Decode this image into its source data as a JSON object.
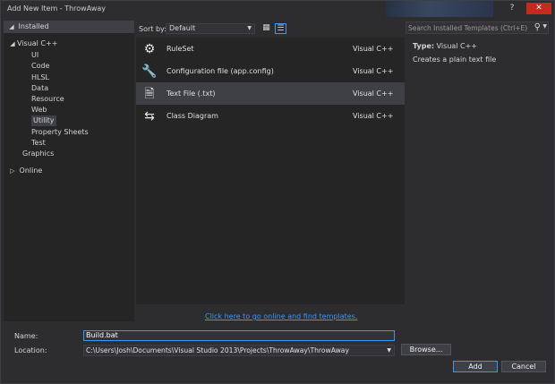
{
  "window": {
    "title": "Add New Item - ThrowAway",
    "help": "?",
    "close": "✕"
  },
  "tree": {
    "installed": "Installed",
    "items": [
      {
        "label": "Visual C++",
        "arrow": "◢",
        "indent": 0
      },
      {
        "label": "UI",
        "indent": 1
      },
      {
        "label": "Code",
        "indent": 1
      },
      {
        "label": "HLSL",
        "indent": 1
      },
      {
        "label": "Data",
        "indent": 1
      },
      {
        "label": "Resource",
        "indent": 1
      },
      {
        "label": "Web",
        "indent": 1
      },
      {
        "label": "Utility",
        "indent": 1,
        "selected": true
      },
      {
        "label": "Property Sheets",
        "indent": 1
      },
      {
        "label": "Test",
        "indent": 1
      },
      {
        "label": "Graphics",
        "indent": 0
      }
    ],
    "online": "Online",
    "arrows": {
      "installed": "◢",
      "online": "▷"
    }
  },
  "sort": {
    "label": "Sort by:",
    "value": "Default",
    "dropdown": "▼"
  },
  "templates": [
    {
      "name": "RuleSet",
      "lang": "Visual C++",
      "icon": "ruleset-icon",
      "glyph": "⚙"
    },
    {
      "name": "Configuration file (app.config)",
      "lang": "Visual C++",
      "icon": "config-file-icon",
      "glyph": "🔧"
    },
    {
      "name": "Text File (.txt)",
      "lang": "Visual C++",
      "icon": "text-file-icon",
      "glyph": "🗎",
      "selected": true
    },
    {
      "name": "Class Diagram",
      "lang": "Visual C++",
      "icon": "class-diagram-icon",
      "glyph": "⇆"
    }
  ],
  "online_link": "Click here to go online and find templates.",
  "search": {
    "placeholder": "Search Installed Templates (Ctrl+E)",
    "icon_glyph": "⚲",
    "dropdown": "▼"
  },
  "details": {
    "type_label": "Type:",
    "type_value": "Visual C++",
    "description": "Creates a plain text file"
  },
  "form": {
    "name_label": "Name:",
    "name_value": "Build.bat",
    "location_label": "Location:",
    "location_value": "C:\\Users\\Josh\\Documents\\Visual Studio 2013\\Projects\\ThrowAway\\ThrowAway",
    "location_dropdown": "▼",
    "browse": "Browse...",
    "add": "Add",
    "cancel": "Cancel"
  },
  "view_buttons": {
    "grid_glyph": "▦",
    "list_glyph": "☰"
  },
  "colors": {
    "accent": "#3399ff",
    "background": "#2d2d30",
    "panel": "#252526",
    "selection": "#3f3f46",
    "close": "#c42b1c"
  }
}
